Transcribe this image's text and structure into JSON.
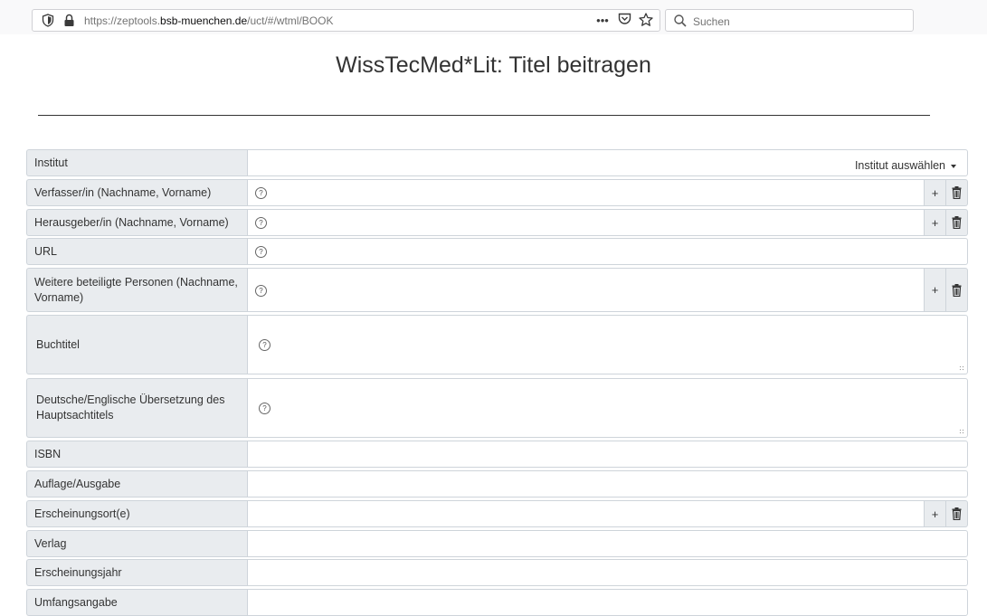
{
  "browser": {
    "url_prefix": "https://zeptools.",
    "url_host": "bsb-muenchen.de",
    "url_path": "/uct/#/wtml/BOOK",
    "menu_dots": "•••",
    "search_placeholder": "Suchen"
  },
  "page": {
    "title": "WissTecMed*Lit: Titel beitragen"
  },
  "form": {
    "institut": {
      "label": "Institut",
      "dropdown": "Institut auswählen"
    },
    "verfasser": {
      "label": "Verfasser/in (Nachname, Vorname)"
    },
    "herausgeber": {
      "label": "Herausgeber/in (Nachname, Vorname)"
    },
    "url": {
      "label": "URL"
    },
    "weitere": {
      "label": "Weitere beteiligte Personen (Nachname, Vorname)"
    },
    "buchtitel": {
      "label": "Buchtitel"
    },
    "uebersetzung": {
      "label": "Deutsche/Englische Übersetzung des Hauptsachtitels"
    },
    "isbn": {
      "label": "ISBN"
    },
    "auflage": {
      "label": "Auflage/Ausgabe"
    },
    "ort": {
      "label": "Erscheinungsort(e)"
    },
    "verlag": {
      "label": "Verlag"
    },
    "jahr": {
      "label": "Erscheinungsjahr"
    },
    "umfang": {
      "label": "Umfangsangabe"
    }
  },
  "buttons": {
    "add": "+",
    "help": "?"
  },
  "icons": {
    "shield": "shield-icon",
    "lock": "lock-icon",
    "pocket": "pocket-icon",
    "bookmark": "star-icon",
    "search": "search-icon",
    "trash": "trash-icon"
  }
}
